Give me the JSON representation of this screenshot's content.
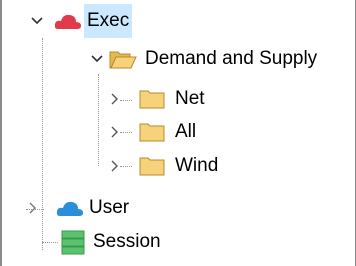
{
  "tree": {
    "exec": {
      "label": "Exec",
      "expanded": true,
      "selected": true,
      "icon": "red-cloud-icon"
    },
    "demand_supply": {
      "label": "Demand and Supply",
      "expanded": true,
      "icon": "open-folder-icon"
    },
    "children": [
      {
        "label": "Net",
        "icon": "folder-icon"
      },
      {
        "label": "All",
        "icon": "folder-icon"
      },
      {
        "label": "Wind",
        "icon": "folder-icon"
      }
    ],
    "user": {
      "label": "User",
      "expanded": false,
      "icon": "blue-cloud-icon"
    },
    "session": {
      "label": "Session",
      "icon": "database-icon"
    }
  },
  "colors": {
    "selection": "#cce8ff",
    "folder": "#f6d37a",
    "red_cloud": "#e23a4a",
    "blue_cloud": "#2a8fd8",
    "database": "#5cc26e"
  }
}
